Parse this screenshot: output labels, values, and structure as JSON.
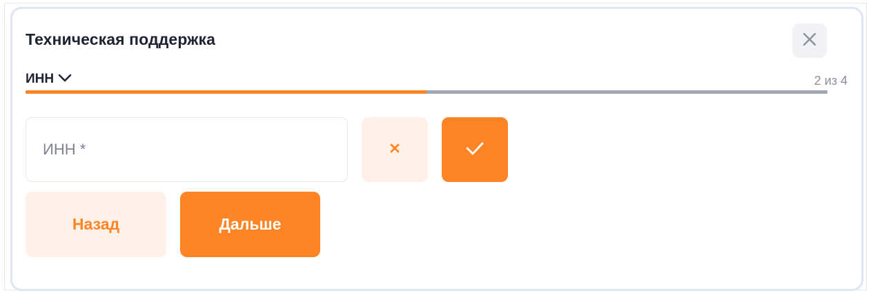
{
  "dialog": {
    "title": "Техническая поддержка",
    "close_icon": "close-icon"
  },
  "step": {
    "label": "ИНН",
    "dropdown_icon": "chevron-down-icon",
    "counter": "2 из 4",
    "progress_fraction": 0.5
  },
  "form": {
    "inn_placeholder": "ИНН *",
    "inn_value": "",
    "clear_icon": "x-icon",
    "confirm_icon": "check-icon"
  },
  "actions": {
    "back_label": "Назад",
    "next_label": "Дальше"
  },
  "colors": {
    "accent": "#ff8426",
    "accent_light": "#fff1e7",
    "progress_track": "#a2a6b2",
    "text": "#1f2330",
    "muted": "#8a8f9c"
  }
}
